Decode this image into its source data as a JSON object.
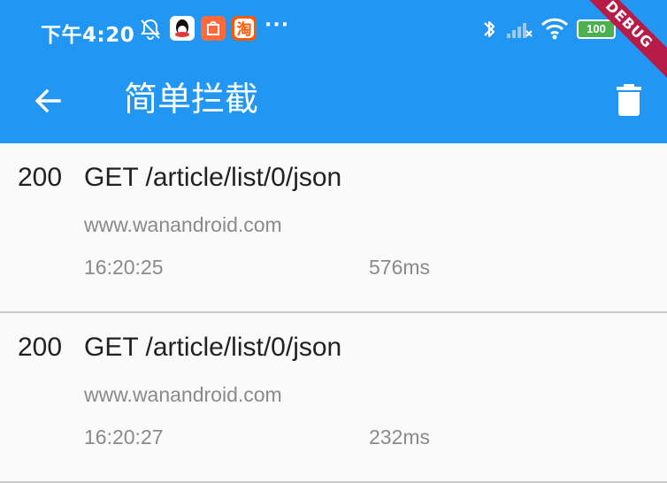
{
  "status_bar": {
    "time": "下午4:20",
    "battery": "100",
    "more": "···",
    "taobao_icon_text": "淘"
  },
  "app_bar": {
    "title": "简单拦截"
  },
  "debug_banner": "DEBUG",
  "colors": {
    "primary": "#2196f3",
    "background": "#fafafa",
    "divider": "#c8c8c8",
    "secondary_text": "#8a8a8a",
    "debug_banner": "#b71c48"
  },
  "requests": [
    {
      "status_code": "200",
      "method": "GET",
      "path": "/article/list/0/json",
      "host": "www.wanandroid.com",
      "time": "16:20:25",
      "duration": "576ms"
    },
    {
      "status_code": "200",
      "method": "GET",
      "path": "/article/list/0/json",
      "host": "www.wanandroid.com",
      "time": "16:20:27",
      "duration": "232ms"
    }
  ]
}
